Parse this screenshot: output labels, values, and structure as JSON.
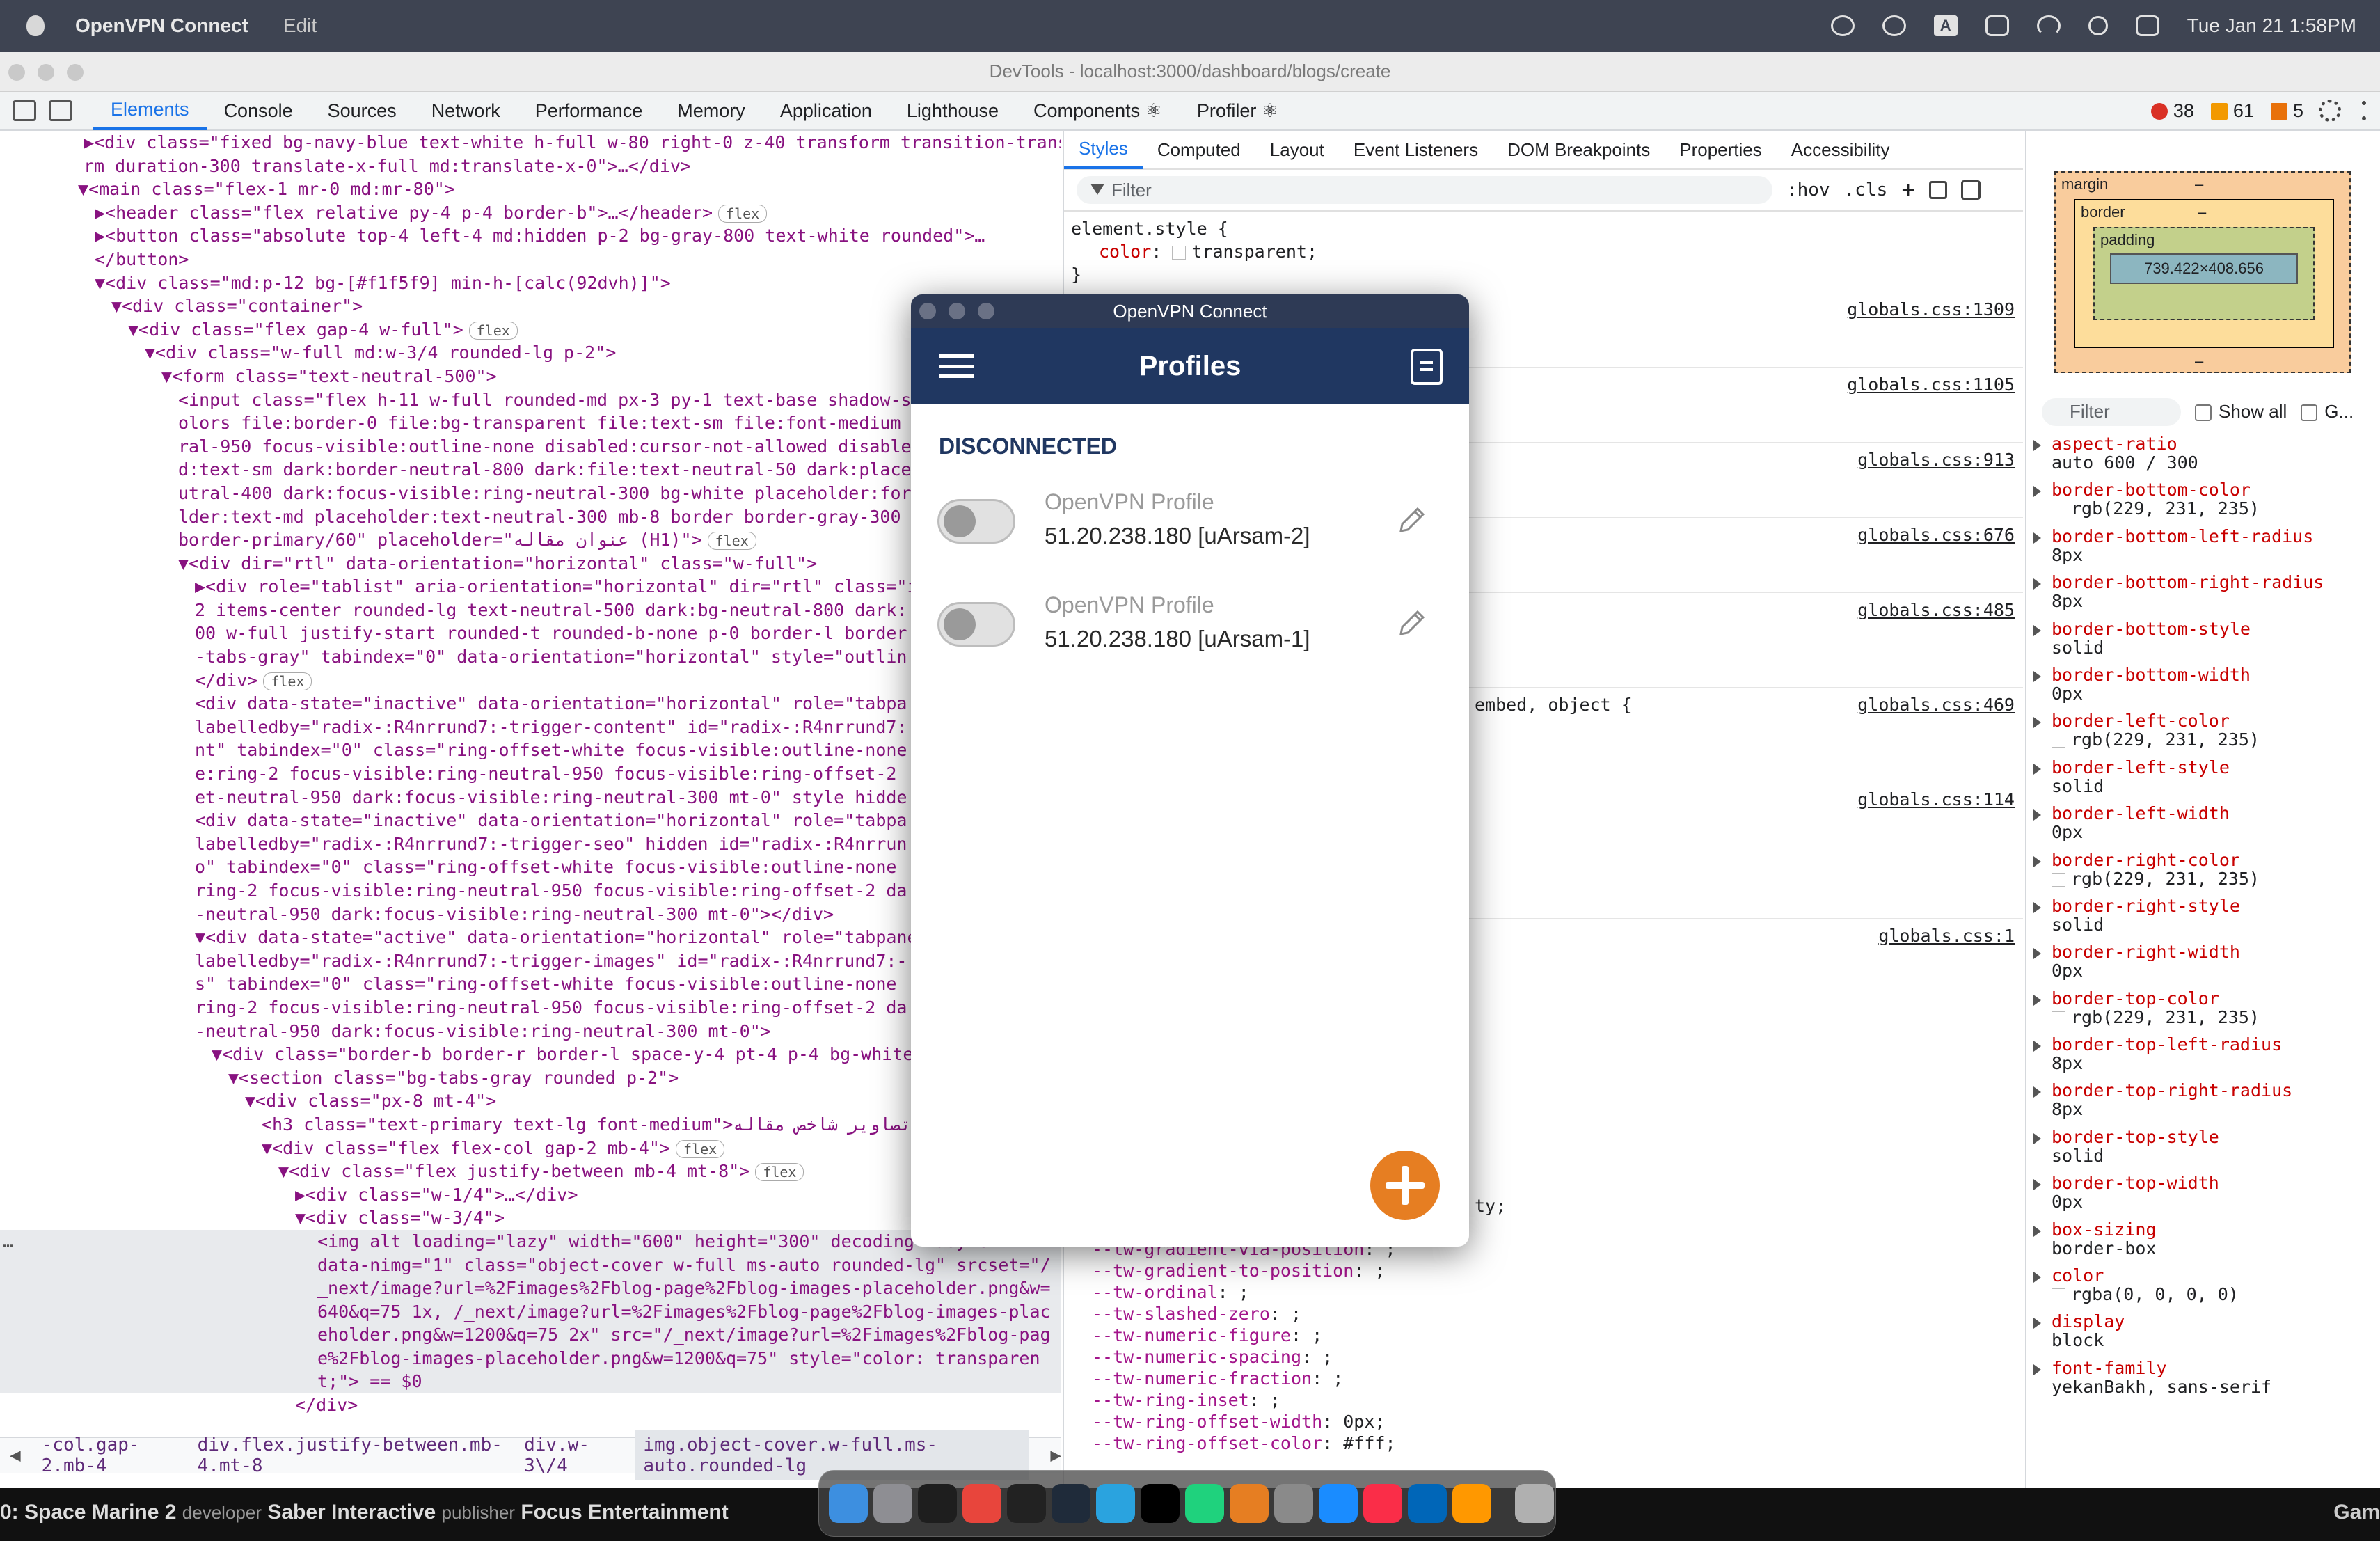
{
  "menubar": {
    "app_name": "OpenVPN Connect",
    "menu_edit": "Edit",
    "datetime": "Tue Jan 21  1:58PM",
    "input_indicator": "A"
  },
  "devtools": {
    "window_title": "DevTools - localhost:3000/dashboard/blogs/create",
    "tabs": [
      "Elements",
      "Console",
      "Sources",
      "Network",
      "Performance",
      "Memory",
      "Application",
      "Lighthouse",
      "Components ⚛",
      "Profiler ⚛"
    ],
    "errors": "38",
    "warnings": "61",
    "issues": "5",
    "side_tabs": [
      "Styles",
      "Computed",
      "Layout",
      "Event Listeners",
      "DOM Breakpoints",
      "Properties",
      "Accessibility"
    ],
    "filter_placeholder": "Filter",
    "hov": ":hov",
    "cls": ".cls",
    "element_style": {
      "selector": "element.style {",
      "prop": "color",
      "value": "transparent;",
      "close": "}"
    },
    "rule_sources": [
      "globals.css:1309",
      "globals.css:1105",
      "globals.css:913",
      "globals.css:676",
      "globals.css:485",
      "globals.css:469",
      "globals.css:114",
      "globals.css:1"
    ],
    "rule_selector_partial": "embed, object {",
    "rule_partial_tail": "ty;",
    "tw_vars": [
      [
        "--tw-gradient-from-position",
        " ;"
      ],
      [
        "--tw-gradient-via-position",
        " ;"
      ],
      [
        "--tw-gradient-to-position",
        " ;"
      ],
      [
        "--tw-ordinal",
        " ;"
      ],
      [
        "--tw-slashed-zero",
        " ;"
      ],
      [
        "--tw-numeric-figure",
        " ;"
      ],
      [
        "--tw-numeric-spacing",
        " ;"
      ],
      [
        "--tw-numeric-fraction",
        " ;"
      ],
      [
        "--tw-ring-inset",
        " ;"
      ],
      [
        "--tw-ring-offset-width",
        " 0px;"
      ],
      [
        "--tw-ring-offset-color",
        " #fff;"
      ]
    ],
    "breadcrumbs": [
      "-col.gap-2.mb-4",
      "div.flex.justify-between.mb-4.mt-8",
      "div.w-3\\/4",
      "img.object-cover.w-full.ms-auto.rounded-lg"
    ]
  },
  "elements": {
    "lines": [
      "▶<div class=\"fixed bg-navy-blue text-white h-full w-80 right-0 z-40 transform transition-transfo",
      "rm duration-300 translate-x-full md:translate-x-0\">…</div>",
      "▼<main class=\"flex-1 mr-0 md:mr-80\">",
      "▶<header class=\"flex relative py-4 p-4 border-b\">…</header> [flex]",
      "▶<button class=\"absolute top-4 left-4 md:hidden p-2 bg-gray-800 text-white rounded\">…",
      "</button>",
      "▼<div class=\"md:p-12 bg-[#f1f5f9] min-h-[calc(92dvh)]\">",
      "▼<div class=\"container\">",
      "▼<div class=\"flex gap-4 w-full\"> [flex]",
      "▼<div class=\"w-full md:w-3/4 rounded-lg p-2\">",
      "▼<form class=\"text-neutral-500\">",
      "<input class=\"flex h-11 w-full rounded-md px-3 py-1 text-base shadow-s",
      "olors file:border-0 file:bg-transparent file:text-sm file:font-medium",
      "ral-950 focus-visible:outline-none disabled:cursor-not-allowed disable",
      "d:text-sm dark:border-neutral-800 dark:file:text-neutral-50 dark:place",
      "utral-400 dark:focus-visible:ring-neutral-300 bg-white placeholder:for",
      "lder:text-md placeholder:text-neutral-300 mb-8 border border-gray-300",
      "border-primary/60\" placeholder=\"عنوان مقاله (H1)\"> [flex]",
      "▼<div dir=\"rtl\" data-orientation=\"horizontal\" class=\"w-full\">",
      "▶<div role=\"tablist\" aria-orientation=\"horizontal\" dir=\"rtl\" class=\"i",
      "2 items-center rounded-lg text-neutral-500 dark:bg-neutral-800 dark:",
      "00 w-full justify-start rounded-t rounded-b-none p-0 border-l border",
      "-tabs-gray\" tabindex=\"0\" data-orientation=\"horizontal\" style=\"outlin",
      "</div> [flex]",
      "<div data-state=\"inactive\" data-orientation=\"horizontal\" role=\"tabpa",
      "labelledby=\"radix-:R4nrrund7:-trigger-content\" id=\"radix-:R4nrrund7:",
      "nt\" tabindex=\"0\" class=\"ring-offset-white focus-visible:outline-none",
      "e:ring-2 focus-visible:ring-neutral-950 focus-visible:ring-offset-2",
      "et-neutral-950 dark:focus-visible:ring-neutral-300 mt-0\" style hidde",
      "<div data-state=\"inactive\" data-orientation=\"horizontal\" role=\"tabpa",
      "labelledby=\"radix-:R4nrrund7:-trigger-seo\" hidden id=\"radix-:R4nrrun",
      "o\" tabindex=\"0\" class=\"ring-offset-white focus-visible:outline-none",
      "ring-2 focus-visible:ring-neutral-950 focus-visible:ring-offset-2 da",
      "-neutral-950 dark:focus-visible:ring-neutral-300 mt-0\"></div>",
      "▼<div data-state=\"active\" data-orientation=\"horizontal\" role=\"tabpane",
      "labelledby=\"radix-:R4nrrund7:-trigger-images\" id=\"radix-:R4nrrund7:-",
      "s\" tabindex=\"0\" class=\"ring-offset-white focus-visible:outline-none",
      "ring-2 focus-visible:ring-neutral-950 focus-visible:ring-offset-2 da",
      "-neutral-950 dark:focus-visible:ring-neutral-300 mt-0\">",
      "▼<div class=\"border-b border-r border-l space-y-4 pt-4 p-4 bg-white",
      "▼<section class=\"bg-tabs-gray rounded p-2\">",
      "▼<div class=\"px-8 mt-4\">",
      "<h3 class=\"text-primary text-lg font-medium\">تصاویر شاخص مقاله",
      "▼<div class=\"flex flex-col gap-2 mb-4\"> [flex]",
      "▼<div class=\"flex justify-between mb-4 mt-8\"> [flex]",
      "▶<div class=\"w-1/4\">…</div>",
      "▼<div class=\"w-3/4\">",
      "<img alt loading=\"lazy\" width=\"600\" height=\"300\" decoding=\"async\"",
      "data-nimg=\"1\" class=\"object-cover w-full ms-auto rounded-lg\" srcset=\"/",
      "_next/image?url=%2Fimages%2Fblog-page%2Fblog-images-placeholder.png&w=",
      "640&q=75 1x, /_next/image?url=%2Fimages%2Fblog-page%2Fblog-images-plac",
      "eholder.png&w=1200&q=75 2x\" src=\"/_next/image?url=%2Fimages%2Fblog-pag",
      "e%2Fblog-images-placeholder.png&w=1200&q=75\" style=\"color: transparen",
      "t;\"> == $0",
      "</div>"
    ],
    "selection_marker": "…"
  },
  "computed": {
    "box": {
      "margin": "margin",
      "border": "border",
      "padding": "padding",
      "content": "739.422×408.656",
      "dash": "–"
    },
    "filter_placeholder": "Filter",
    "show_all": "Show all",
    "group": "G...",
    "props": [
      [
        "aspect-ratio",
        "auto 600 / 300"
      ],
      [
        "border-bottom-color",
        "rgb(229, 231, 235)"
      ],
      [
        "border-bottom-left-radius",
        "8px"
      ],
      [
        "border-bottom-right-radius",
        "8px"
      ],
      [
        "border-bottom-style",
        "solid"
      ],
      [
        "border-bottom-width",
        "0px"
      ],
      [
        "border-left-color",
        "rgb(229, 231, 235)"
      ],
      [
        "border-left-style",
        "solid"
      ],
      [
        "border-left-width",
        "0px"
      ],
      [
        "border-right-color",
        "rgb(229, 231, 235)"
      ],
      [
        "border-right-style",
        "solid"
      ],
      [
        "border-right-width",
        "0px"
      ],
      [
        "border-top-color",
        "rgb(229, 231, 235)"
      ],
      [
        "border-top-left-radius",
        "8px"
      ],
      [
        "border-top-right-radius",
        "8px"
      ],
      [
        "border-top-style",
        "solid"
      ],
      [
        "border-top-width",
        "0px"
      ],
      [
        "box-sizing",
        "border-box"
      ],
      [
        "color",
        "rgba(0, 0, 0, 0)"
      ],
      [
        "display",
        "block"
      ],
      [
        "font-family",
        "yekanBakh, sans-serif"
      ]
    ]
  },
  "openvpn": {
    "window_title": "OpenVPN Connect",
    "header_title": "Profiles",
    "status": "DISCONNECTED",
    "profiles": [
      {
        "name": "OpenVPN Profile",
        "address": "51.20.238.180 [uArsam-2]"
      },
      {
        "name": "OpenVPN Profile",
        "address": "51.20.238.180 [uArsam-1]"
      }
    ],
    "colors": {
      "header": "#203761",
      "fab": "#e67e22"
    }
  },
  "wallpaper": {
    "text_a": "0: Space Marine 2",
    "text_b": "developer",
    "text_c": "Saber Interactive",
    "text_d": "publisher",
    "text_e": "Focus Entertainment",
    "text_f": "Gam"
  },
  "dock": {
    "apps": [
      "finder-icon",
      "launchpad-icon",
      "terminal-icon",
      "chrome-icon",
      "chatgpt-icon",
      "vscode-insiders-icon",
      "telegram-icon",
      "phpstorm-icon",
      "pycharm-icon",
      "openvpn-icon",
      "system-settings-icon",
      "app-store-icon",
      "music-icon",
      "vscode-icon",
      "sublime-icon",
      "trash-icon"
    ]
  }
}
